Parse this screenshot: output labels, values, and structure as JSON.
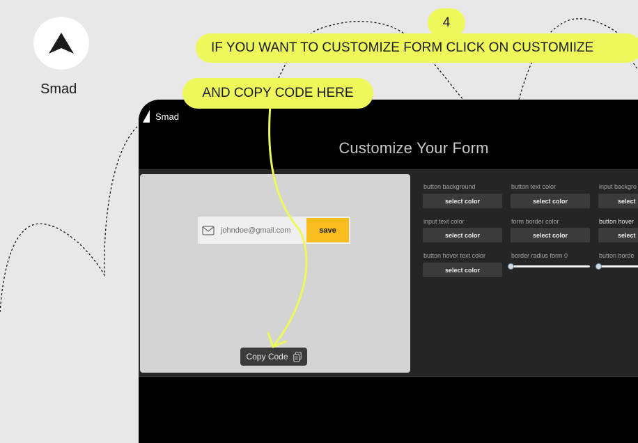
{
  "brand": {
    "name": "Smad",
    "logo_icon": "navigation-arrow-icon"
  },
  "tutorial": {
    "step_number": "4",
    "callout_customize": "IF YOU WANT TO CUSTOMIZE FORM  CLICK ON CUSTOMIIZE",
    "callout_copy": "AND COPY CODE  HERE",
    "accent_color": "#eef85a"
  },
  "window": {
    "app_name": "Smad",
    "page_title": "Customize Your Form"
  },
  "preview": {
    "email_placeholder": "johndoe@gmail.com",
    "save_label": "save",
    "copy_code_label": "Copy Code",
    "save_color": "#f7bd1f"
  },
  "options": {
    "button_background": {
      "label": "button background",
      "action": "select color"
    },
    "button_text_color": {
      "label": "button text color",
      "action": "select color"
    },
    "input_background": {
      "label": "input backgro",
      "action": "select"
    },
    "input_text_color": {
      "label": "input text color",
      "action": "select color"
    },
    "form_border_color": {
      "label": "form border color",
      "action": "select color"
    },
    "button_hover": {
      "label": "button hover",
      "action": "select"
    },
    "button_hover_text_color": {
      "label": "button hover text color",
      "action": "select color"
    },
    "border_radius_form": {
      "label": "border radius form 0",
      "value": 0
    },
    "button_border": {
      "label": "button borde",
      "value": 0
    }
  }
}
